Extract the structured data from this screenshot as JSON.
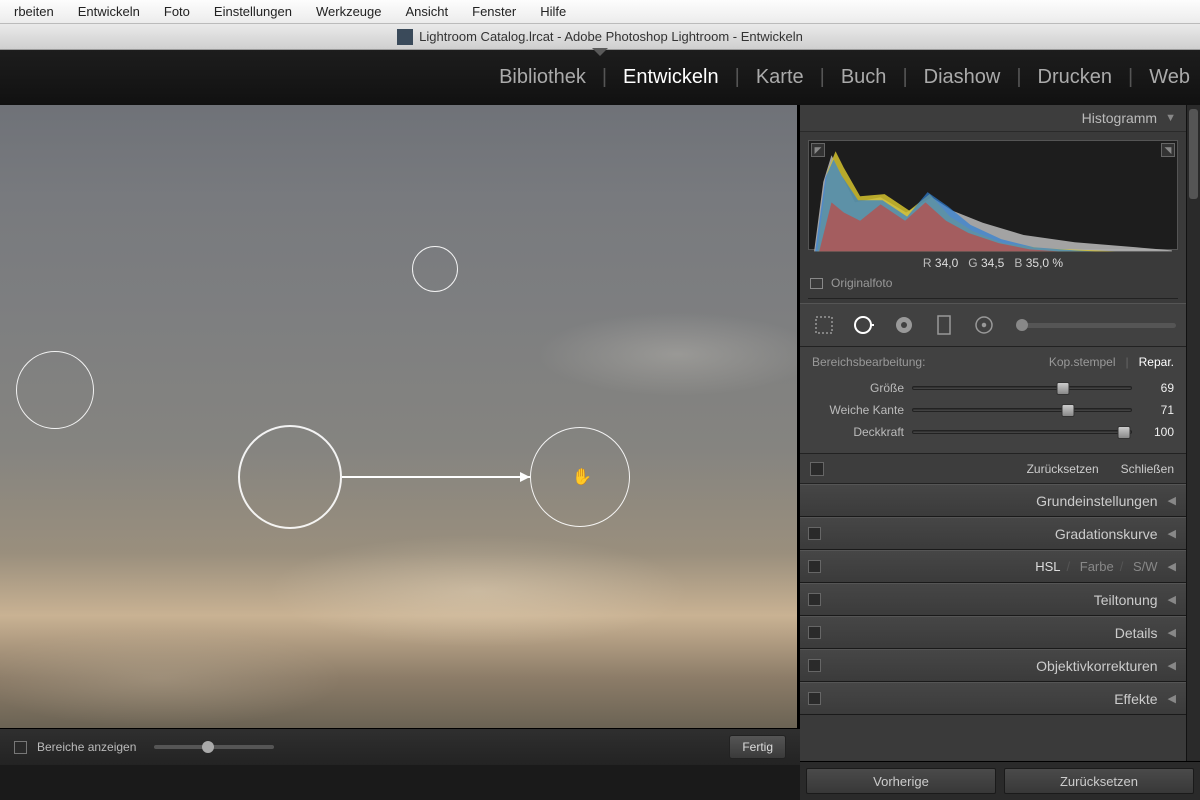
{
  "menubar": [
    "rbeiten",
    "Entwickeln",
    "Foto",
    "Einstellungen",
    "Werkzeuge",
    "Ansicht",
    "Fenster",
    "Hilfe"
  ],
  "window_title": "Lightroom Catalog.lrcat - Adobe Photoshop Lightroom - Entwickeln",
  "modules": [
    {
      "label": "Bibliothek",
      "active": false
    },
    {
      "label": "Entwickeln",
      "active": true
    },
    {
      "label": "Karte",
      "active": false
    },
    {
      "label": "Buch",
      "active": false
    },
    {
      "label": "Diashow",
      "active": false
    },
    {
      "label": "Drucken",
      "active": false
    },
    {
      "label": "Web",
      "active": false
    }
  ],
  "bottom_toolbar": {
    "show_areas_label": "Bereiche anzeigen",
    "done_label": "Fertig"
  },
  "histogram": {
    "title": "Histogramm",
    "rgb": {
      "r_label": "R",
      "r": "34,0",
      "g_label": "G",
      "g": "34,5",
      "b_label": "B",
      "b": "35,0",
      "pct": "%"
    },
    "original_label": "Originalfoto"
  },
  "spot": {
    "title": "Bereichsbearbeitung:",
    "mode_clone": "Kop.stempel",
    "mode_heal": "Repar.",
    "sliders": {
      "size": {
        "label": "Größe",
        "value": 69
      },
      "feather": {
        "label": "Weiche Kante",
        "value": 71
      },
      "opacity": {
        "label": "Deckkraft",
        "value": 100
      }
    },
    "reset": "Zurücksetzen",
    "close": "Schließen"
  },
  "sections": {
    "basic": "Grundeinstellungen",
    "tonecurve": "Gradationskurve",
    "hsl": {
      "main": "HSL",
      "color": "Farbe",
      "bw": "S/W"
    },
    "split": "Teiltonung",
    "detail": "Details",
    "lens": "Objektivkorrekturen",
    "effects": "Effekte"
  },
  "footer": {
    "prev": "Vorherige",
    "reset": "Zurücksetzen"
  }
}
